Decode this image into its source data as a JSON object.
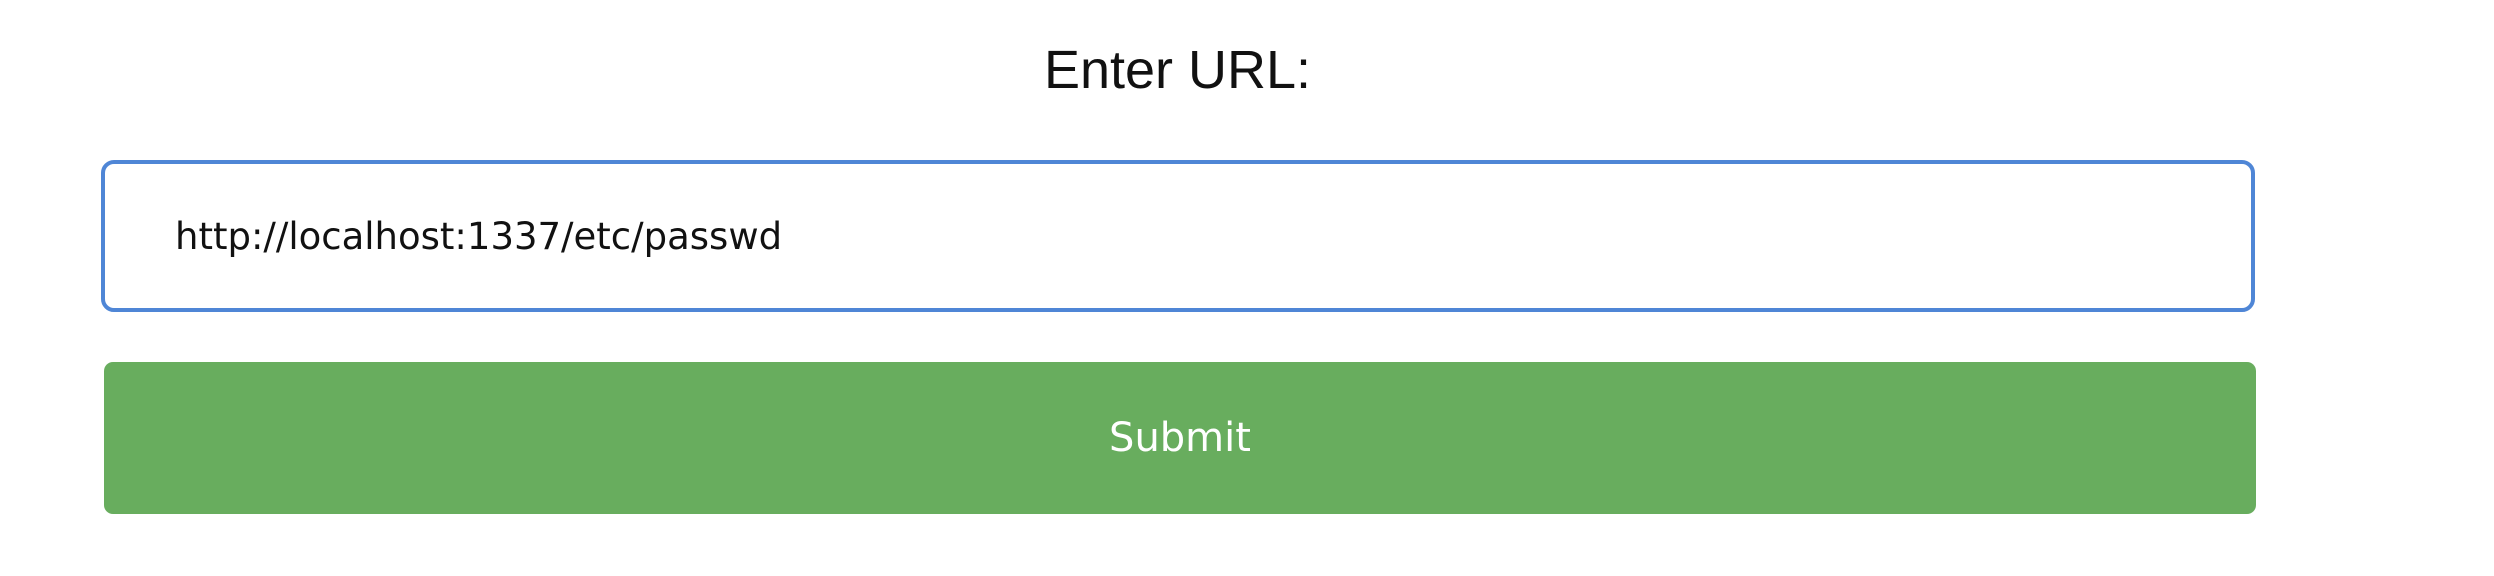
{
  "form": {
    "label": "Enter URL:",
    "url_value": "http://localhost:1337/etc/passwd",
    "submit_label": "Submit"
  },
  "colors": {
    "input_focus_border": "#4f86d6",
    "submit_background": "#68ad5e",
    "submit_text": "#ffffff",
    "label_text": "#111111"
  }
}
